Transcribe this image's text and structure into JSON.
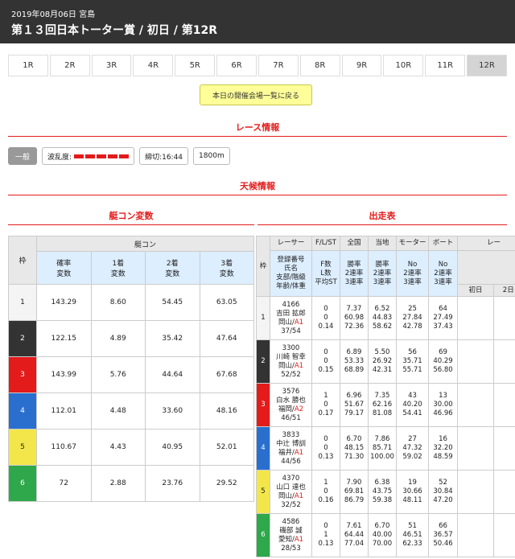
{
  "header": {
    "date": "2019年08月06日 宮島",
    "title": "第１３回日本トーター賞 / 初日 / 第12R"
  },
  "race_tabs": [
    {
      "label": "1R",
      "active": false
    },
    {
      "label": "2R",
      "active": false
    },
    {
      "label": "3R",
      "active": false
    },
    {
      "label": "4R",
      "active": false
    },
    {
      "label": "5R",
      "active": false
    },
    {
      "label": "6R",
      "active": false
    },
    {
      "label": "7R",
      "active": false
    },
    {
      "label": "8R",
      "active": false
    },
    {
      "label": "9R",
      "active": false
    },
    {
      "label": "10R",
      "active": false
    },
    {
      "label": "11R",
      "active": false
    },
    {
      "label": "12R",
      "active": true
    }
  ],
  "back_button": "本日の開催会場一覧に戻る",
  "sections": {
    "race_info": "レース情報",
    "weather": "天候情報",
    "boat_con": "艇コン変数",
    "entries": "出走表"
  },
  "race_info": {
    "grade": "一般",
    "wave_label": "波乱度:",
    "deadline": "締切:16:44",
    "distance": "1800m"
  },
  "colors": {
    "accent_red": "#e41b1b",
    "header_bg": "#333333",
    "frames": [
      "#ffffff",
      "#333333",
      "#e41b1b",
      "#2a6fce",
      "#f2e64a",
      "#2ea84a"
    ]
  },
  "boat_con": {
    "group_header": "艇コン",
    "frame_header": "枠",
    "columns": [
      "確率\n変数",
      "1着\n変数",
      "2着\n変数",
      "3着\n変数"
    ],
    "rows": [
      {
        "frame": "1",
        "v": [
          "143.29",
          "8.60",
          "54.45",
          "63.05"
        ]
      },
      {
        "frame": "2",
        "v": [
          "122.15",
          "4.89",
          "35.42",
          "47.64"
        ]
      },
      {
        "frame": "3",
        "v": [
          "143.99",
          "5.76",
          "44.64",
          "67.68"
        ]
      },
      {
        "frame": "4",
        "v": [
          "112.01",
          "4.48",
          "33.60",
          "48.16"
        ]
      },
      {
        "frame": "5",
        "v": [
          "110.67",
          "4.43",
          "40.95",
          "52.01"
        ]
      },
      {
        "frame": "6",
        "v": [
          "72",
          "2.88",
          "23.76",
          "29.52"
        ]
      }
    ]
  },
  "entries": {
    "head1": [
      "レーサー",
      "F/L/ST",
      "全国",
      "当地",
      "モーター",
      "ボート",
      "レー"
    ],
    "frame_header": "枠",
    "head2": [
      "登録番号\n氏名\n支部/階級\n年齢/体重",
      "F数\nL数\n平均ST",
      "勝率\n2連率\n3連率",
      "勝率\n2連率\n3連率",
      "No\n2連率\n3連率",
      "No\n2連率\n3連率"
    ],
    "sub": [
      "初日",
      "2日目"
    ],
    "rows": [
      {
        "frame": "1",
        "reg": "4166",
        "name": "吉田 拡郎",
        "branch": "岡山/",
        "cls": "A1",
        "age": "37/54",
        "fl": "0\n0\n0.14",
        "nat": "7.37\n60.98\n72.36",
        "loc": "6.52\n44.83\n58.62",
        "mot": "25\n27.84\n42.78",
        "boat": "64\n27.49\n37.43"
      },
      {
        "frame": "2",
        "reg": "3300",
        "name": "川崎 智幸",
        "branch": "岡山/",
        "cls": "A1",
        "age": "52/52",
        "fl": "0\n0\n0.15",
        "nat": "6.89\n53.33\n68.89",
        "loc": "5.50\n26.92\n42.31",
        "mot": "56\n35.71\n55.71",
        "boat": "69\n40.29\n56.80"
      },
      {
        "frame": "3",
        "reg": "3576",
        "name": "白水 勝也",
        "branch": "福岡/",
        "cls": "A2",
        "age": "46/51",
        "fl": "1\n0\n0.17",
        "nat": "6.96\n51.67\n79.17",
        "loc": "7.35\n62.16\n81.08",
        "mot": "43\n40.20\n54.41",
        "boat": "13\n30.00\n46.96"
      },
      {
        "frame": "4",
        "reg": "3833",
        "name": "中辻 博訓",
        "branch": "福井/",
        "cls": "A1",
        "age": "44/56",
        "fl": "0\n0\n0.13",
        "nat": "6.70\n48.15\n71.30",
        "loc": "7.86\n85.71\n100.00",
        "mot": "27\n47.32\n59.02",
        "boat": "16\n32.20\n48.59"
      },
      {
        "frame": "5",
        "reg": "4370",
        "name": "山口 達也",
        "branch": "岡山/",
        "cls": "A1",
        "age": "32/52",
        "fl": "1\n0\n0.16",
        "nat": "7.90\n69.81\n86.79",
        "loc": "6.38\n43.75\n59.38",
        "mot": "19\n30.66\n48.11",
        "boat": "52\n30.84\n47.20"
      },
      {
        "frame": "6",
        "reg": "4586",
        "name": "磯部 誠",
        "branch": "愛知/",
        "cls": "A1",
        "age": "28/53",
        "fl": "0\n1\n0.13",
        "nat": "7.61\n64.44\n77.04",
        "loc": "6.70\n40.00\n70.00",
        "mot": "51\n46.51\n62.33",
        "boat": "66\n36.57\n50.46"
      }
    ]
  }
}
